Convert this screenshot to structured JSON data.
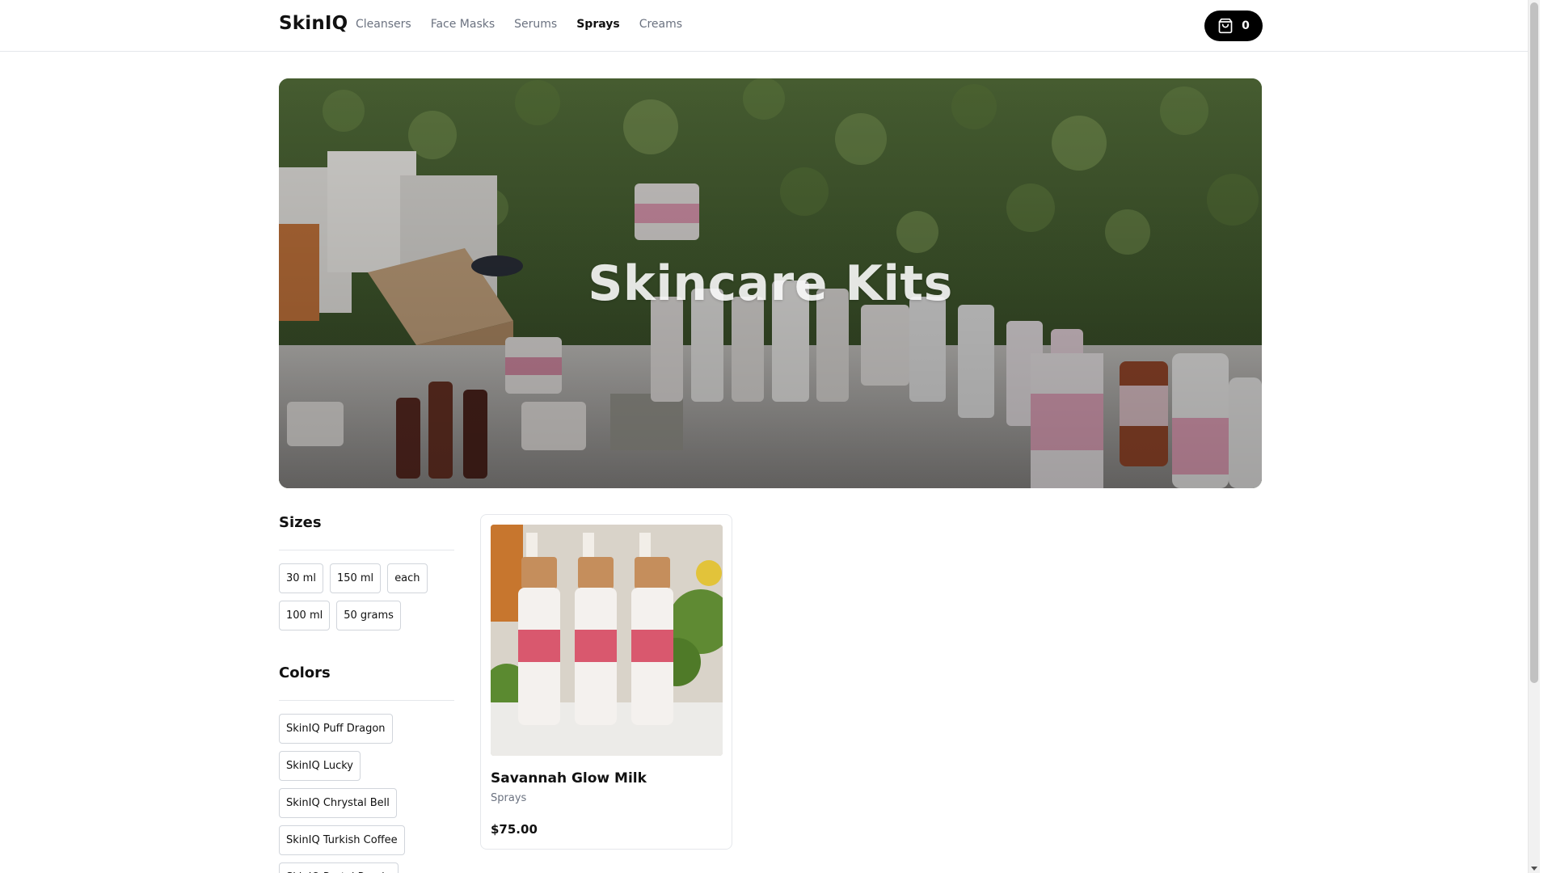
{
  "header": {
    "logo": "SkinIQ",
    "nav": [
      {
        "label": "Cleansers",
        "active": false
      },
      {
        "label": "Face Masks",
        "active": false
      },
      {
        "label": "Serums",
        "active": false
      },
      {
        "label": "Sprays",
        "active": true
      },
      {
        "label": "Creams",
        "active": false
      }
    ],
    "cart_count": "0"
  },
  "hero": {
    "title": "Skincare Kits"
  },
  "filters": {
    "sizes": {
      "heading": "Sizes",
      "options": [
        "30 ml",
        "150 ml",
        "each",
        "100 ml",
        "50 grams"
      ]
    },
    "colors": {
      "heading": "Colors",
      "options": [
        "SkinIQ Puff Dragon",
        "SkinIQ Lucky",
        "SkinIQ Chrystal Bell",
        "SkinIQ Turkish Coffee",
        "SkinIQ Pastel Purple"
      ]
    }
  },
  "products": [
    {
      "name": "Savannah Glow Milk",
      "category": "Sprays",
      "price": "$75.00"
    }
  ],
  "icons": {
    "cart": "shopping-bag-icon"
  },
  "colors": {
    "accent": "#000000",
    "muted_text": "#6b7280",
    "border": "#e5e7eb"
  }
}
